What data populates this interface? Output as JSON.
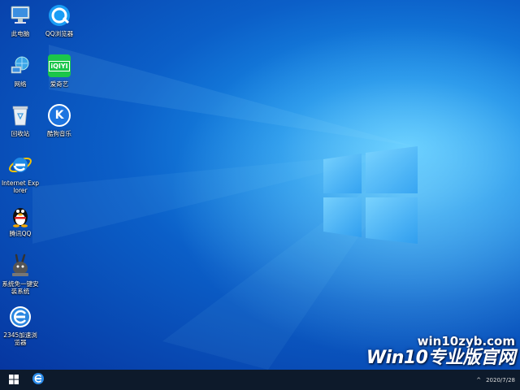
{
  "desktop": {
    "icons": [
      {
        "label": "此电脑",
        "icon": "computer-icon"
      },
      {
        "label": "QQ浏览器",
        "icon": "qq-browser-icon"
      },
      {
        "label": "网络",
        "icon": "network-icon"
      },
      {
        "label": "爱奇艺",
        "icon": "iqiyi-icon"
      },
      {
        "label": "回收站",
        "icon": "recycle-bin-icon"
      },
      {
        "label": "酷狗音乐",
        "icon": "kugou-icon"
      },
      {
        "label": "Internet Explorer",
        "icon": "internet-explorer-icon"
      },
      {
        "label": "腾讯QQ",
        "icon": "qq-penguin-icon"
      },
      {
        "label": "系统免一键安装系统",
        "icon": "installer-rabbit-icon"
      },
      {
        "label": "2345加速浏览器",
        "icon": "2345-browser-icon"
      }
    ],
    "iqiyi_text": "iQIYI",
    "kugou_text": "K"
  },
  "watermark": {
    "url": "win10zyb.com",
    "brand": "Win10专业版官网"
  },
  "taskbar": {
    "start_icon": "windows-start-icon",
    "pinned_icon": "edge-browser-icon",
    "tray_date": "2020/7/28"
  },
  "colors": {
    "desktop_center": "#54c6ff",
    "desktop_edge": "#0636a0",
    "taskbar": "#0d1a2b"
  }
}
